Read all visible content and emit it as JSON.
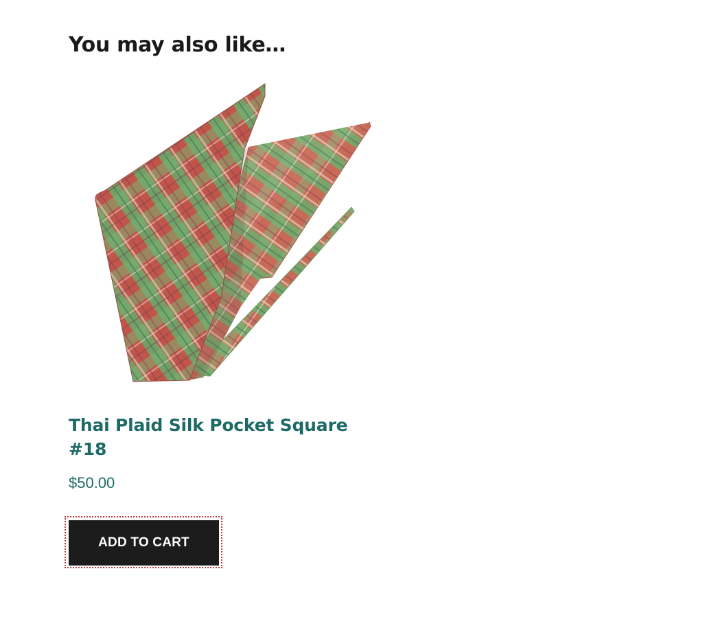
{
  "related": {
    "heading": "You may also like…",
    "product": {
      "title": "Thai Plaid Silk Pocket Square #18",
      "image_alt": "Thai Plaid Silk Pocket Square #18",
      "price": "$50.00",
      "add_to_cart_label": "ADD TO CART"
    }
  },
  "colors": {
    "title": "#1e6a66",
    "button_bg": "#1c1c1c",
    "fabric_red": "#c0564a",
    "fabric_green": "#6ea86a"
  }
}
